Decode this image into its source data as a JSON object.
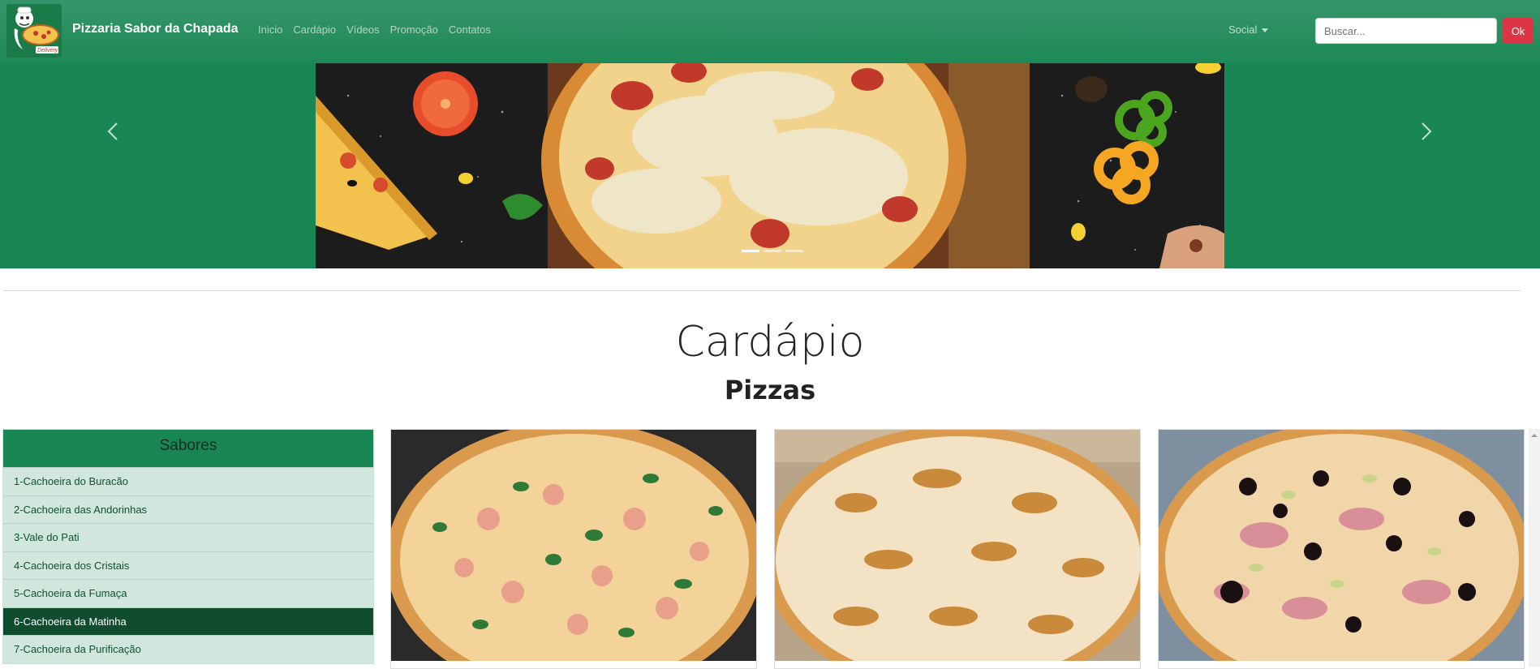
{
  "header": {
    "brand": "Pizzaria Sabor da Chapada",
    "nav": [
      "Inicio",
      "Cardápio",
      "Vídeos",
      "Promoção",
      "Contatos"
    ],
    "social_label": "Social",
    "search_placeholder": "Buscar...",
    "search_button": "Ok"
  },
  "page": {
    "title": "Cardápio",
    "subtitle": "Pizzas"
  },
  "sidebar": {
    "heading": "Sabores",
    "items": [
      "1-Cachoeira do Buracão",
      "2-Cachoeira das Andorinhas",
      "3-Vale do Pati",
      "4-Cachoeira dos Cristais",
      "5-Cachoeira da Fumaça",
      "6-Cachoeira da Matinha",
      "7-Cachoeira da Purificação"
    ],
    "active_index": 5
  },
  "colors": {
    "brand_green": "#198754",
    "dark_green": "#0f4d2e",
    "light_green": "#d1e7dd",
    "danger": "#dc3545"
  }
}
